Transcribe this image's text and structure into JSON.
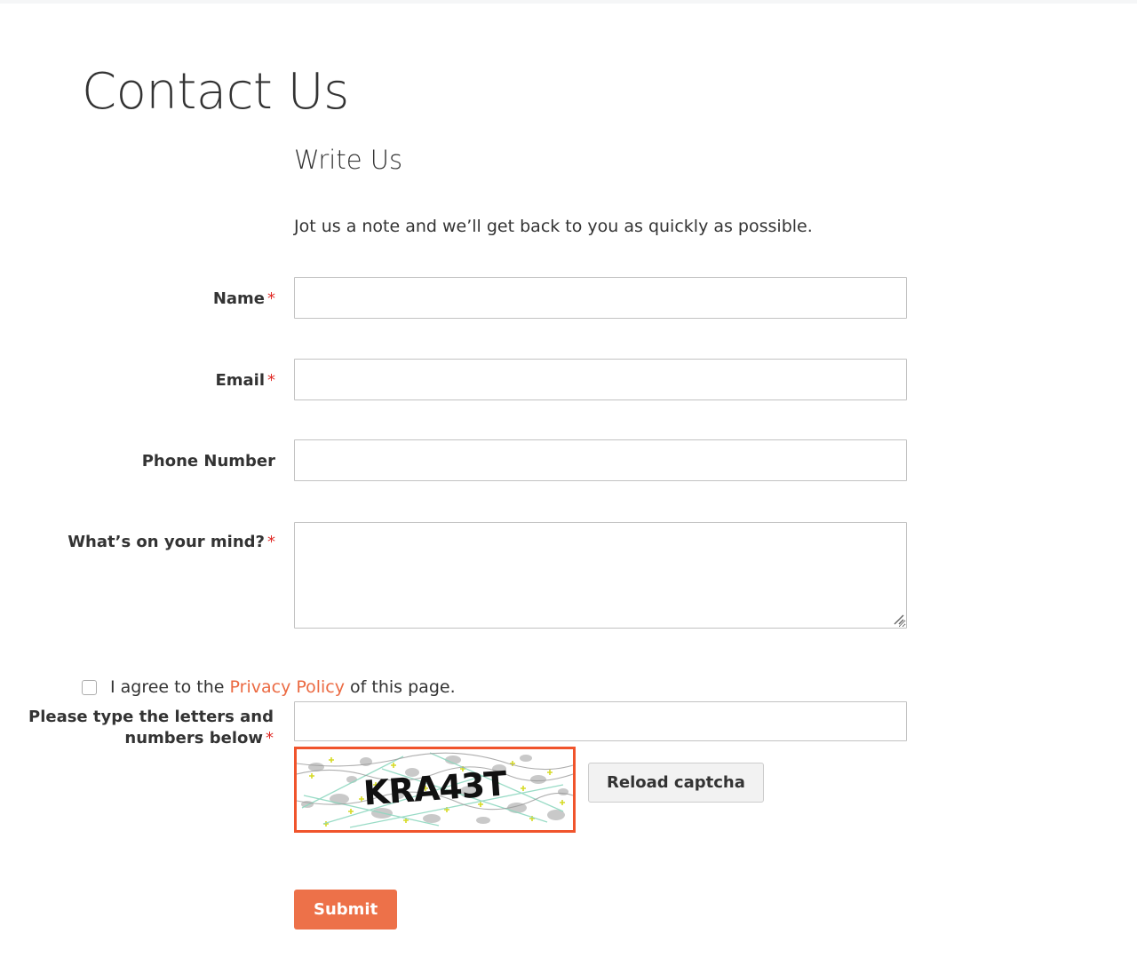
{
  "page": {
    "title": "Contact Us"
  },
  "form": {
    "legend": "Write Us",
    "note": "Jot us a note and we’ll get back to you as quickly as possible.",
    "required_marker": "*",
    "fields": [
      {
        "label": "Name",
        "required": true,
        "value": "",
        "placeholder": ""
      },
      {
        "label": "Email",
        "required": true,
        "value": "",
        "placeholder": ""
      },
      {
        "label": "Phone Number",
        "required": false,
        "value": "",
        "placeholder": ""
      },
      {
        "label": "What’s on your mind?",
        "required": true,
        "value": "",
        "placeholder": ""
      }
    ],
    "agreement": {
      "text_before": "I agree to the",
      "link_label": "Privacy Policy",
      "text_after": "of this page.",
      "checked": false
    },
    "captcha": {
      "label": "Please type the letters and numbers below",
      "required": true,
      "value": "",
      "placeholder": "",
      "image_text": "KRA43T",
      "reload_label": "Reload captcha"
    },
    "submit_label": "Submit"
  },
  "colors": {
    "accent_orange": "#ed7149",
    "link_orange": "#eb6a42",
    "captcha_border": "#f0542c",
    "required_red": "#e02b27",
    "text": "#333333",
    "input_border": "#c2c2c2",
    "button_gray": "#f2f2f2"
  }
}
